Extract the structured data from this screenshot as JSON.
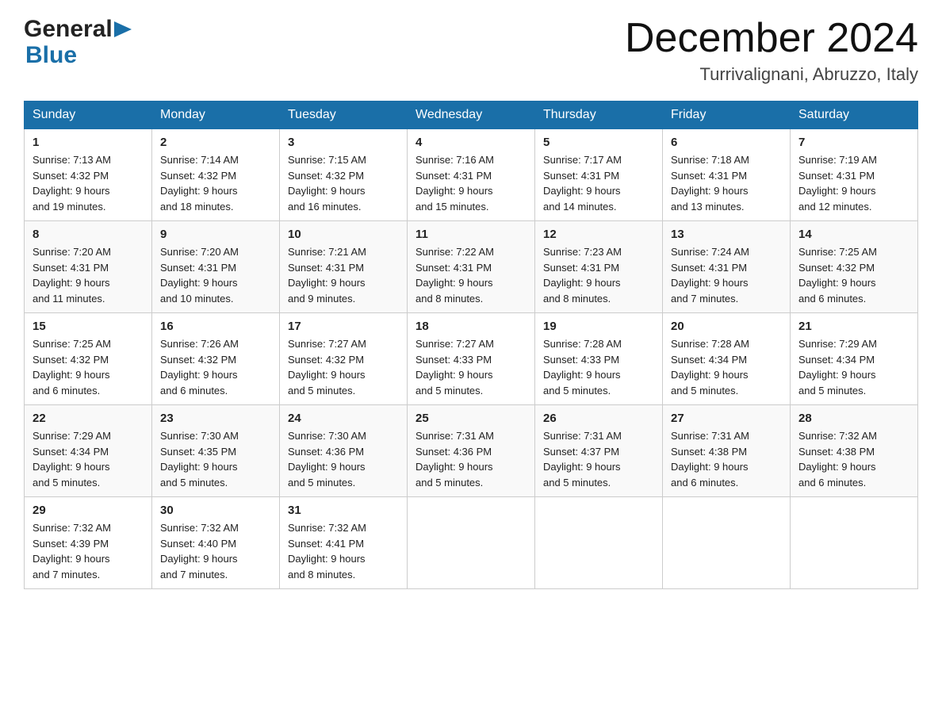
{
  "header": {
    "logo_general": "General",
    "logo_blue": "Blue",
    "month_title": "December 2024",
    "location": "Turrivalignani, Abruzzo, Italy"
  },
  "weekdays": [
    "Sunday",
    "Monday",
    "Tuesday",
    "Wednesday",
    "Thursday",
    "Friday",
    "Saturday"
  ],
  "weeks": [
    [
      {
        "day": "1",
        "sunrise": "7:13 AM",
        "sunset": "4:32 PM",
        "daylight": "9 hours and 19 minutes."
      },
      {
        "day": "2",
        "sunrise": "7:14 AM",
        "sunset": "4:32 PM",
        "daylight": "9 hours and 18 minutes."
      },
      {
        "day": "3",
        "sunrise": "7:15 AM",
        "sunset": "4:32 PM",
        "daylight": "9 hours and 16 minutes."
      },
      {
        "day": "4",
        "sunrise": "7:16 AM",
        "sunset": "4:31 PM",
        "daylight": "9 hours and 15 minutes."
      },
      {
        "day": "5",
        "sunrise": "7:17 AM",
        "sunset": "4:31 PM",
        "daylight": "9 hours and 14 minutes."
      },
      {
        "day": "6",
        "sunrise": "7:18 AM",
        "sunset": "4:31 PM",
        "daylight": "9 hours and 13 minutes."
      },
      {
        "day": "7",
        "sunrise": "7:19 AM",
        "sunset": "4:31 PM",
        "daylight": "9 hours and 12 minutes."
      }
    ],
    [
      {
        "day": "8",
        "sunrise": "7:20 AM",
        "sunset": "4:31 PM",
        "daylight": "9 hours and 11 minutes."
      },
      {
        "day": "9",
        "sunrise": "7:20 AM",
        "sunset": "4:31 PM",
        "daylight": "9 hours and 10 minutes."
      },
      {
        "day": "10",
        "sunrise": "7:21 AM",
        "sunset": "4:31 PM",
        "daylight": "9 hours and 9 minutes."
      },
      {
        "day": "11",
        "sunrise": "7:22 AM",
        "sunset": "4:31 PM",
        "daylight": "9 hours and 8 minutes."
      },
      {
        "day": "12",
        "sunrise": "7:23 AM",
        "sunset": "4:31 PM",
        "daylight": "9 hours and 8 minutes."
      },
      {
        "day": "13",
        "sunrise": "7:24 AM",
        "sunset": "4:31 PM",
        "daylight": "9 hours and 7 minutes."
      },
      {
        "day": "14",
        "sunrise": "7:25 AM",
        "sunset": "4:32 PM",
        "daylight": "9 hours and 6 minutes."
      }
    ],
    [
      {
        "day": "15",
        "sunrise": "7:25 AM",
        "sunset": "4:32 PM",
        "daylight": "9 hours and 6 minutes."
      },
      {
        "day": "16",
        "sunrise": "7:26 AM",
        "sunset": "4:32 PM",
        "daylight": "9 hours and 6 minutes."
      },
      {
        "day": "17",
        "sunrise": "7:27 AM",
        "sunset": "4:32 PM",
        "daylight": "9 hours and 5 minutes."
      },
      {
        "day": "18",
        "sunrise": "7:27 AM",
        "sunset": "4:33 PM",
        "daylight": "9 hours and 5 minutes."
      },
      {
        "day": "19",
        "sunrise": "7:28 AM",
        "sunset": "4:33 PM",
        "daylight": "9 hours and 5 minutes."
      },
      {
        "day": "20",
        "sunrise": "7:28 AM",
        "sunset": "4:34 PM",
        "daylight": "9 hours and 5 minutes."
      },
      {
        "day": "21",
        "sunrise": "7:29 AM",
        "sunset": "4:34 PM",
        "daylight": "9 hours and 5 minutes."
      }
    ],
    [
      {
        "day": "22",
        "sunrise": "7:29 AM",
        "sunset": "4:34 PM",
        "daylight": "9 hours and 5 minutes."
      },
      {
        "day": "23",
        "sunrise": "7:30 AM",
        "sunset": "4:35 PM",
        "daylight": "9 hours and 5 minutes."
      },
      {
        "day": "24",
        "sunrise": "7:30 AM",
        "sunset": "4:36 PM",
        "daylight": "9 hours and 5 minutes."
      },
      {
        "day": "25",
        "sunrise": "7:31 AM",
        "sunset": "4:36 PM",
        "daylight": "9 hours and 5 minutes."
      },
      {
        "day": "26",
        "sunrise": "7:31 AM",
        "sunset": "4:37 PM",
        "daylight": "9 hours and 5 minutes."
      },
      {
        "day": "27",
        "sunrise": "7:31 AM",
        "sunset": "4:38 PM",
        "daylight": "9 hours and 6 minutes."
      },
      {
        "day": "28",
        "sunrise": "7:32 AM",
        "sunset": "4:38 PM",
        "daylight": "9 hours and 6 minutes."
      }
    ],
    [
      {
        "day": "29",
        "sunrise": "7:32 AM",
        "sunset": "4:39 PM",
        "daylight": "9 hours and 7 minutes."
      },
      {
        "day": "30",
        "sunrise": "7:32 AM",
        "sunset": "4:40 PM",
        "daylight": "9 hours and 7 minutes."
      },
      {
        "day": "31",
        "sunrise": "7:32 AM",
        "sunset": "4:41 PM",
        "daylight": "9 hours and 8 minutes."
      },
      null,
      null,
      null,
      null
    ]
  ]
}
